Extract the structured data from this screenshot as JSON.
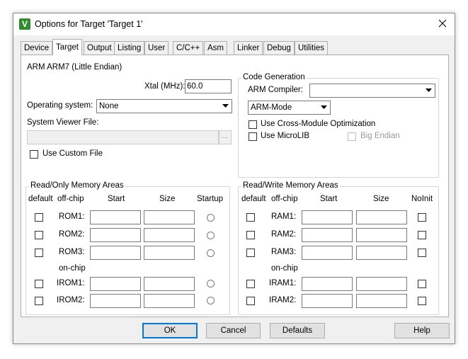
{
  "window": {
    "title": "Options for Target 'Target 1'",
    "icon_letter": "V",
    "close_icon": "close-icon"
  },
  "tabs": [
    {
      "label": "Device"
    },
    {
      "label": "Target"
    },
    {
      "label": "Output"
    },
    {
      "label": "Listing"
    },
    {
      "label": "User"
    },
    {
      "label": "C/C++"
    },
    {
      "label": "Asm"
    },
    {
      "label": "Linker"
    },
    {
      "label": "Debug"
    },
    {
      "label": "Utilities"
    }
  ],
  "active_tab": "Target",
  "target": {
    "device_name": "ARM ARM7 (Little Endian)",
    "xtal_label": "Xtal (MHz):",
    "xtal_value": "60.0",
    "os_label": "Operating system:",
    "os_value": "None",
    "svf_label": "System Viewer File:",
    "svf_value": "",
    "browse_label": "...",
    "use_custom_file_label": "Use Custom File"
  },
  "code_generation": {
    "legend": "Code Generation",
    "compiler_label": "ARM Compiler:",
    "compiler_value": "",
    "mode_value": "ARM-Mode",
    "cross_module_label": "Use Cross-Module Optimization",
    "microlib_label": "Use MicroLIB",
    "big_endian_label": "Big Endian"
  },
  "rom_areas": {
    "legend": "Read/Only Memory Areas",
    "headers": {
      "default": "default",
      "offchip": "off-chip",
      "start": "Start",
      "size": "Size",
      "startup": "Startup"
    },
    "onchip_label": "on-chip",
    "rows": [
      {
        "label": "ROM1:",
        "start": "",
        "size": ""
      },
      {
        "label": "ROM2:",
        "start": "",
        "size": ""
      },
      {
        "label": "ROM3:",
        "start": "",
        "size": ""
      },
      {
        "label": "IROM1:",
        "start": "",
        "size": ""
      },
      {
        "label": "IROM2:",
        "start": "",
        "size": ""
      }
    ]
  },
  "ram_areas": {
    "legend": "Read/Write Memory Areas",
    "headers": {
      "default": "default",
      "offchip": "off-chip",
      "start": "Start",
      "size": "Size",
      "noinit": "NoInit"
    },
    "onchip_label": "on-chip",
    "rows": [
      {
        "label": "RAM1:",
        "start": "",
        "size": ""
      },
      {
        "label": "RAM2:",
        "start": "",
        "size": ""
      },
      {
        "label": "RAM3:",
        "start": "",
        "size": ""
      },
      {
        "label": "IRAM1:",
        "start": "",
        "size": ""
      },
      {
        "label": "IRAM2:",
        "start": "",
        "size": ""
      }
    ]
  },
  "buttons": {
    "ok": "OK",
    "cancel": "Cancel",
    "defaults": "Defaults",
    "help": "Help"
  },
  "colors": {
    "accent": "#0078d7",
    "icon_green": "#2f8d2f"
  }
}
